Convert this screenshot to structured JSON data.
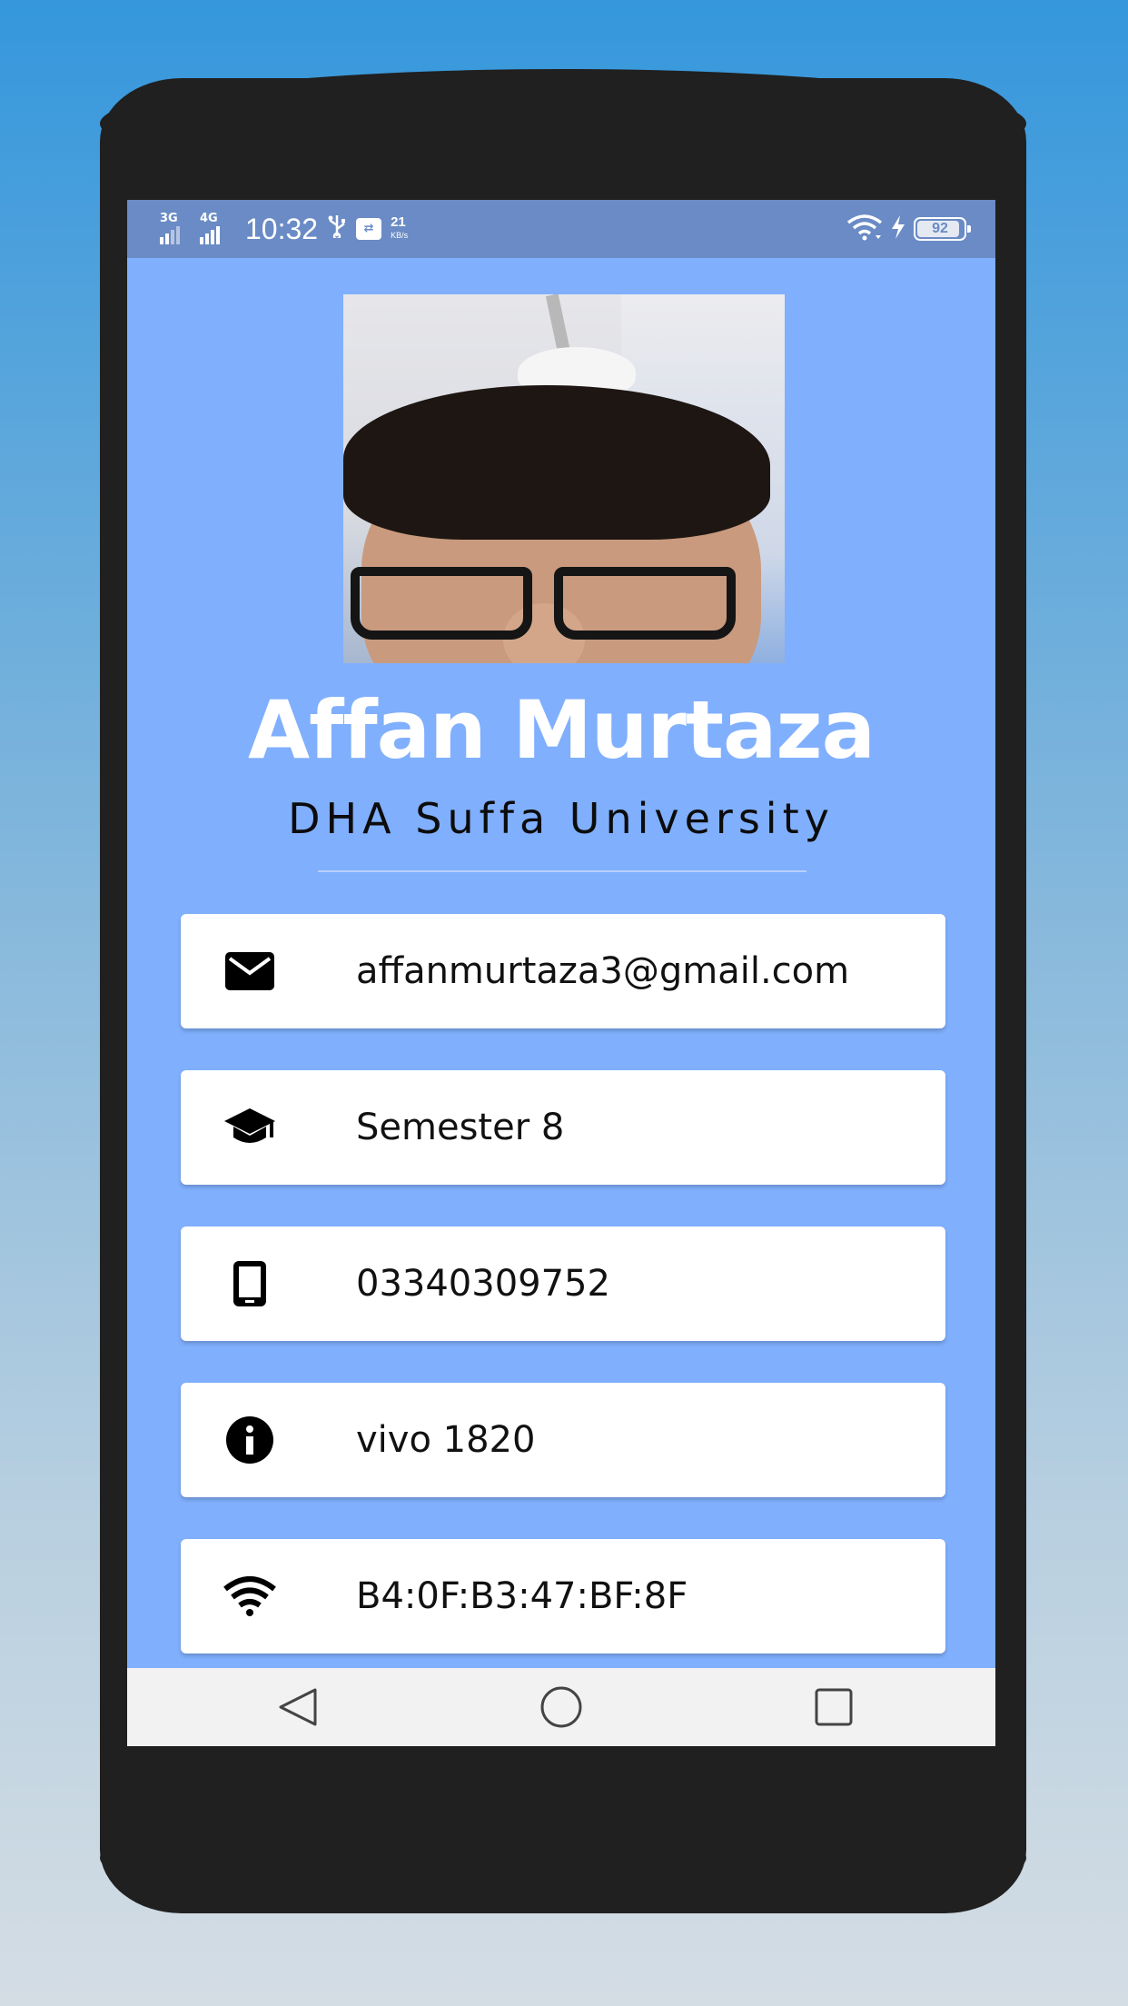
{
  "status_bar": {
    "network_1": "3G",
    "network_2": "4G",
    "time": "10:32",
    "usb_icon": "usb-icon",
    "usb_debug_icon": "usb-debug-icon",
    "speed_value": "21",
    "speed_unit": "KB/s",
    "wifi_icon": "wifi-icon",
    "charging_icon": "lightning-icon",
    "battery_level": "92",
    "battery_fraction": 0.92
  },
  "profile": {
    "name": "Affan Murtaza",
    "university": "DHA Suffa University"
  },
  "cards": [
    {
      "icon": "email-icon",
      "value": "affanmurtaza3@gmail.com"
    },
    {
      "icon": "graduation-cap-icon",
      "value": "Semester 8"
    },
    {
      "icon": "phone-icon",
      "value": "03340309752"
    },
    {
      "icon": "info-icon",
      "value": "vivo 1820"
    },
    {
      "icon": "wifi-icon",
      "value": "B4:0F:B3:47:BF:8F"
    }
  ],
  "nav_bar": {
    "back": "back-icon",
    "home": "home-icon",
    "recents": "recents-icon"
  },
  "colors": {
    "screen_background": "#80affd",
    "status_bar": "#6a8bc5",
    "card_background": "#ffffff",
    "name_text": "#ffffff",
    "phone_body": "#202020"
  }
}
